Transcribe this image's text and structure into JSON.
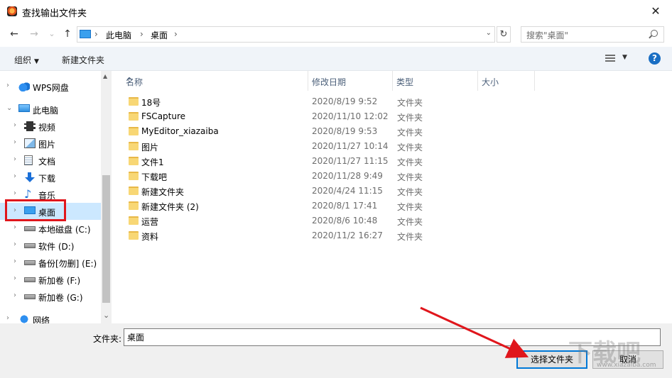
{
  "window": {
    "title": "查找输出文件夹",
    "close_glyph": "✕"
  },
  "nav": {
    "back_glyph": "←",
    "forward_glyph": "→",
    "recent_glyph": "⌄",
    "up_glyph": "↑",
    "breadcrumb": [
      "此电脑",
      "桌面"
    ],
    "breadcrumb_sep": "›",
    "dropdown_glyph": "⌄",
    "refresh_glyph": "↻",
    "search_placeholder": "搜索\"桌面\""
  },
  "toolbar": {
    "organize_label": "组织",
    "organize_caret": "▼",
    "new_folder_label": "新建文件夹",
    "view_caret": "▼",
    "help_label": "?"
  },
  "sidebar": {
    "items": [
      {
        "label": "WPS网盘",
        "icon": "cloud-icon",
        "chevron": "›",
        "level": 0
      },
      {
        "label": "此电脑",
        "icon": "pc-icon",
        "chevron": "⌄",
        "level": 0
      },
      {
        "label": "视频",
        "icon": "video-icon",
        "chevron": "›",
        "level": 1
      },
      {
        "label": "图片",
        "icon": "picture-icon",
        "chevron": "›",
        "level": 1
      },
      {
        "label": "文档",
        "icon": "document-icon",
        "chevron": "›",
        "level": 1
      },
      {
        "label": "下载",
        "icon": "download-icon",
        "chevron": "›",
        "level": 1
      },
      {
        "label": "音乐",
        "icon": "music-icon",
        "chevron": "›",
        "level": 1
      },
      {
        "label": "桌面",
        "icon": "desktop-icon",
        "chevron": "›",
        "level": 1,
        "selected": true
      },
      {
        "label": "本地磁盘 (C:)",
        "icon": "drive-icon",
        "chevron": "›",
        "level": 1
      },
      {
        "label": "软件 (D:)",
        "icon": "drive-icon",
        "chevron": "›",
        "level": 1
      },
      {
        "label": "备份[勿删] (E:)",
        "icon": "drive-icon",
        "chevron": "›",
        "level": 1
      },
      {
        "label": "新加卷 (F:)",
        "icon": "drive-icon",
        "chevron": "›",
        "level": 1
      },
      {
        "label": "新加卷 (G:)",
        "icon": "drive-icon",
        "chevron": "›",
        "level": 1
      },
      {
        "label": "网络",
        "icon": "network-icon",
        "chevron": "›",
        "level": 0
      }
    ],
    "scroll_up": "▲",
    "scroll_down": "⌄"
  },
  "filelist": {
    "columns": [
      "名称",
      "修改日期",
      "类型",
      "大小"
    ],
    "sort_caret": "^",
    "rows": [
      {
        "name": "18号",
        "date": "2020/8/19 9:52",
        "type": "文件夹"
      },
      {
        "name": "FSCapture",
        "date": "2020/11/10 12:02",
        "type": "文件夹"
      },
      {
        "name": "MyEditor_xiazaiba",
        "date": "2020/8/19 9:53",
        "type": "文件夹"
      },
      {
        "name": "图片",
        "date": "2020/11/27 10:14",
        "type": "文件夹"
      },
      {
        "name": "文件1",
        "date": "2020/11/27 11:15",
        "type": "文件夹"
      },
      {
        "name": "下载吧",
        "date": "2020/11/28 9:49",
        "type": "文件夹"
      },
      {
        "name": "新建文件夹",
        "date": "2020/4/24 11:15",
        "type": "文件夹"
      },
      {
        "name": "新建文件夹 (2)",
        "date": "2020/8/1 17:41",
        "type": "文件夹"
      },
      {
        "name": "运营",
        "date": "2020/8/6 10:48",
        "type": "文件夹"
      },
      {
        "name": "资料",
        "date": "2020/11/2 16:27",
        "type": "文件夹"
      }
    ]
  },
  "footer": {
    "folder_label": "文件夹:",
    "folder_value": "桌面",
    "select_button": "选择文件夹",
    "cancel_button": "取消"
  },
  "watermark": {
    "text": "下载吧",
    "url": "www.xiazaiba.com"
  }
}
